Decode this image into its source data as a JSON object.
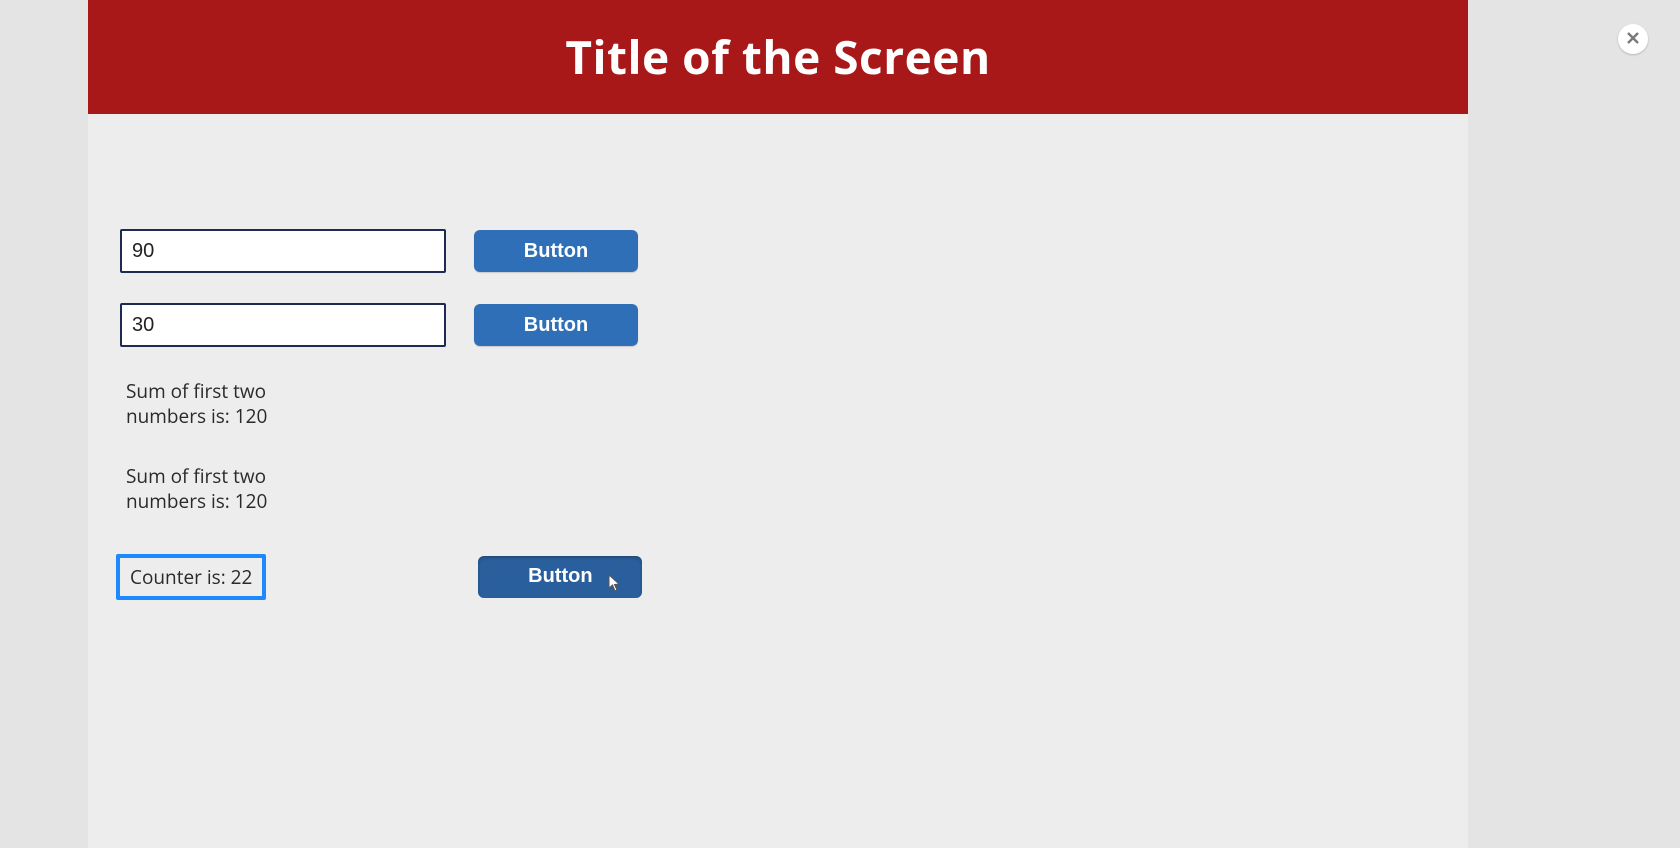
{
  "header": {
    "title": "Title of the Screen"
  },
  "inputs": {
    "first_value": "90",
    "second_value": "30"
  },
  "buttons": {
    "row1_label": "Button",
    "row2_label": "Button",
    "counter_label": "Button"
  },
  "sum_text_1": "Sum of first two numbers is: 120",
  "sum_text_2": "Sum of first two numbers is: 120",
  "counter_text": "Counter is: 22"
}
